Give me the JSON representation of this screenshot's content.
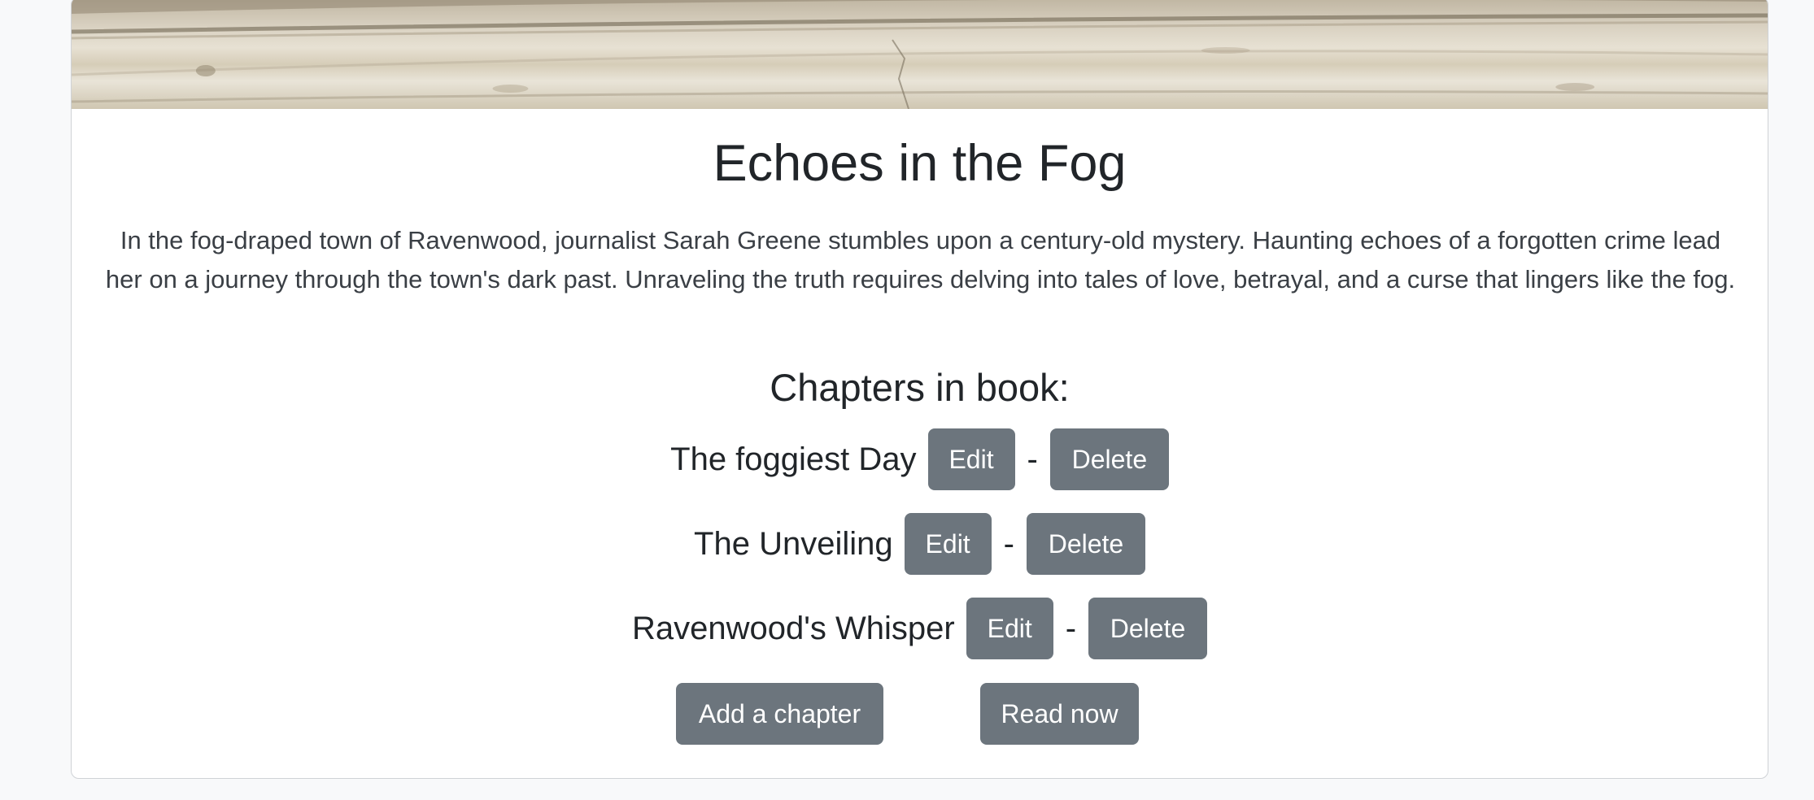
{
  "book": {
    "title": "Echoes in the Fog",
    "description": "In the fog-draped town of Ravenwood, journalist Sarah Greene stumbles upon a century-old mystery. Haunting echoes of a forgotten crime lead her on a journey through the town's dark past. Unraveling the truth requires delving into tales of love, betrayal, and a curse that lingers like the fog."
  },
  "chapters_heading": "Chapters in book:",
  "chapters": [
    {
      "title": "The foggiest Day",
      "edit_label": "Edit",
      "separator": "-",
      "delete_label": "Delete"
    },
    {
      "title": "The Unveiling",
      "edit_label": "Edit",
      "separator": "-",
      "delete_label": "Delete"
    },
    {
      "title": "Ravenwood's Whisper",
      "edit_label": "Edit",
      "separator": "-",
      "delete_label": "Delete"
    }
  ],
  "actions": {
    "add_chapter_label": "Add a chapter",
    "read_now_label": "Read now"
  },
  "colors": {
    "button_bg": "#6c757d",
    "button_text": "#ffffff",
    "page_bg": "#f8f9fa"
  }
}
